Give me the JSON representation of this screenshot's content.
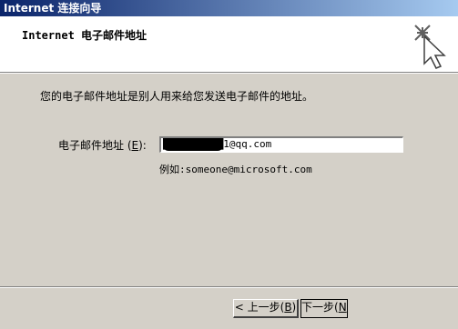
{
  "window": {
    "title": "Internet 连接向导"
  },
  "header": {
    "title": "Internet 电子邮件地址",
    "icon": "wizard-sparkle-icon"
  },
  "main": {
    "instruction": "您的电子邮件地址是别人用来给您发送电子邮件的地址。",
    "email_label_prefix": "电子邮件地址 (",
    "email_label_key": "E",
    "email_label_suffix": "):",
    "email_value_redacted": "██████████",
    "email_value_visible": "1@qq.com",
    "example": "例如:someone@microsoft.com"
  },
  "buttons": {
    "back_prefix": "< 上一步(",
    "back_key": "B",
    "back_suffix": ")",
    "next_prefix": "下一步(",
    "next_key": "N",
    "next_suffix": ")"
  }
}
